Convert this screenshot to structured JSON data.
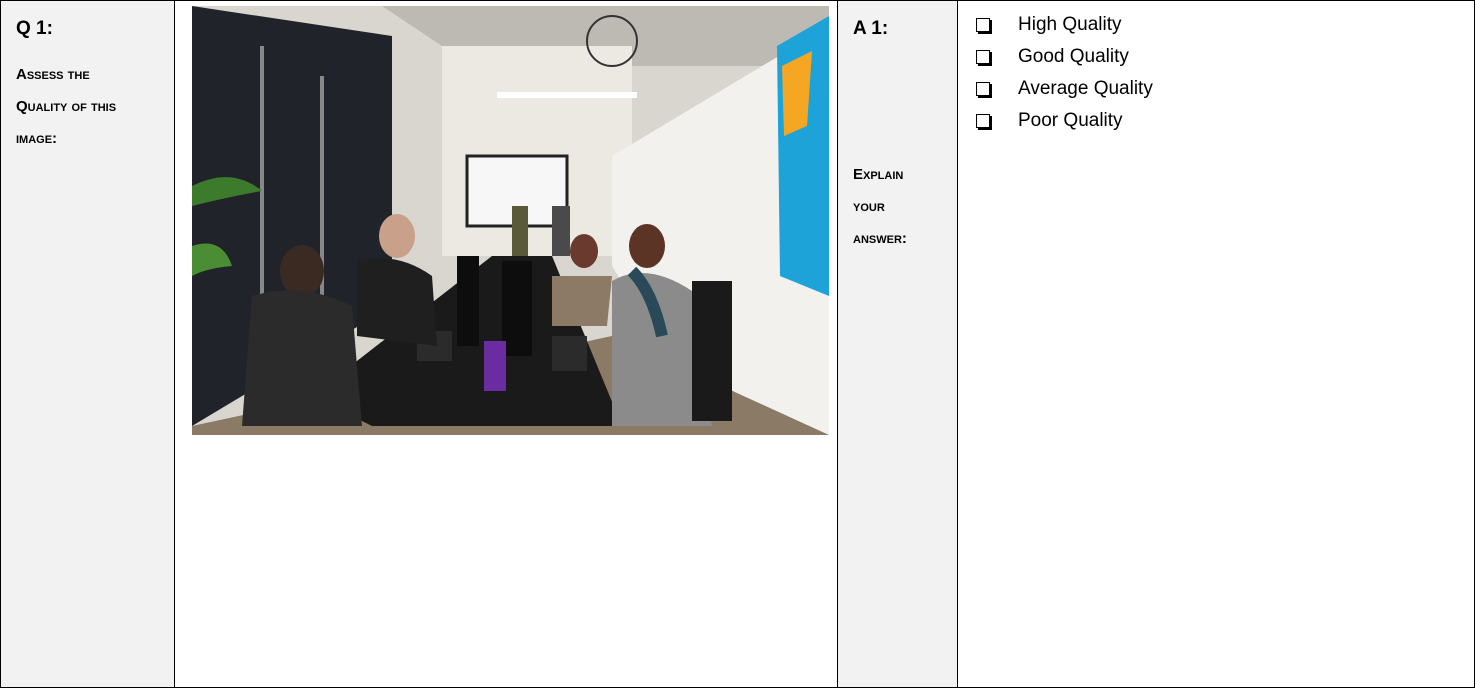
{
  "question": {
    "label": "Q 1:",
    "prompt_lines": [
      "Assess the",
      "Quality of this",
      "image:"
    ]
  },
  "answer": {
    "label": "A 1:",
    "explain_lines": [
      "Explain",
      "your",
      "answer:"
    ],
    "options": [
      "High Quality",
      "Good Quality",
      "Average Quality",
      "Poor Quality"
    ],
    "checkbox_icon": "empty-checkbox-icon"
  },
  "photo": {
    "description_icon": "office-photo",
    "colors": {
      "wall": "#e9e6e0",
      "window": "#1c1f22",
      "desk": "#1a1a1a",
      "floor": "#8a7a66",
      "painting": "#1ea3d9"
    }
  }
}
